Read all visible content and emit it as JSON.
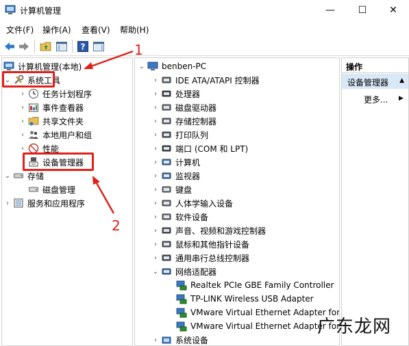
{
  "window": {
    "title": "计算机管理",
    "controls": {
      "minimize": "—",
      "maximize": "☐",
      "close": "✕"
    }
  },
  "menu": [
    "文件(F)",
    "操作(A)",
    "查看(V)",
    "帮助(H)"
  ],
  "left_tree": {
    "root": "计算机管理(本地)",
    "system_tools": "系统工具",
    "children": [
      "任务计划程序",
      "事件查看器",
      "共享文件夹",
      "本地用户和组",
      "性能",
      "设备管理器"
    ],
    "storage": "存储",
    "disk_mgmt": "磁盘管理",
    "services": "服务和应用程序"
  },
  "devices": {
    "computer_name": "benben-PC",
    "categories": [
      "IDE ATA/ATAPI 控制器",
      "处理器",
      "磁盘驱动器",
      "存储控制器",
      "打印队列",
      "端口 (COM 和 LPT)",
      "计算机",
      "监视器",
      "键盘",
      "人体学输入设备",
      "软件设备",
      "声音、视频和游戏控制器",
      "鼠标和其他指针设备",
      "通用串行总线控制器",
      "网络适配器"
    ],
    "network_adapters": [
      "Realtek PCIe GBE Family Controller",
      "TP-LINK Wireless USB Adapter",
      "VMware Virtual Ethernet Adapter for",
      "VMware Virtual Ethernet Adapter for"
    ],
    "last_category": "系统设备"
  },
  "actions": {
    "header": "操作",
    "selected": "设备管理器",
    "more": "更多..."
  },
  "annotations": {
    "one": "1",
    "two": "2"
  },
  "watermark": "广东龙网",
  "colors": {
    "accent_red": "#e0201b",
    "selection_blue": "#d9e8f7"
  }
}
